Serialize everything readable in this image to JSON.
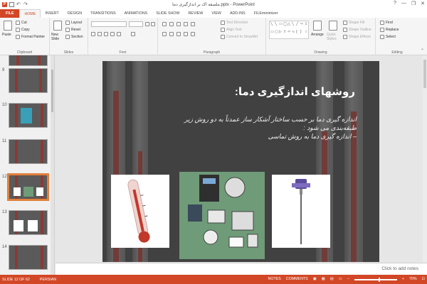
{
  "window": {
    "title": "ملصفه اک بر اندازگیری دما.pptx - PowerPoint",
    "controls": [
      "?",
      "—",
      "❐",
      "✕"
    ]
  },
  "tabs": [
    "FILE",
    "HOME",
    "INSERT",
    "DESIGN",
    "TRANSITIONS",
    "ANIMATIONS",
    "SLIDE SHOW",
    "REVIEW",
    "VIEW",
    "ADD-INS",
    "FILEminimizer"
  ],
  "active_tab": "HOME",
  "ribbon": {
    "clipboard": {
      "label": "Clipboard",
      "paste": "Paste",
      "cut": "Cut",
      "copy": "Copy",
      "format_painter": "Format Painter"
    },
    "slides": {
      "label": "Slides",
      "new_slide": "New Slide",
      "layout": "Layout",
      "reset": "Reset",
      "section": "Section"
    },
    "font": {
      "label": "Font"
    },
    "paragraph": {
      "label": "Paragraph",
      "text_direction": "Text Direction",
      "align_text": "Align Text",
      "convert_smartart": "Convert to SmartArt"
    },
    "drawing": {
      "label": "Drawing",
      "arrange": "Arrange",
      "quick_styles": "Quick Styles",
      "shape_fill": "Shape Fill",
      "shape_outline": "Shape Outline",
      "shape_effects": "Shape Effects"
    },
    "editing": {
      "label": "Editing",
      "find": "Find",
      "replace": "Replace",
      "select": "Select"
    }
  },
  "slide_panel": {
    "thumbnails": [
      {
        "num": "9"
      },
      {
        "num": "10"
      },
      {
        "num": "11"
      },
      {
        "num": "12"
      },
      {
        "num": "13"
      },
      {
        "num": "14"
      }
    ],
    "selected": "12"
  },
  "slide": {
    "title": "روشهای اندازگیری دما:",
    "body_lines": [
      "اندازه گیری دما بر حسب ساختار آشکار ساز عمدتاً به دو روش زیر",
      "طبقه‌بندی می شود :",
      "– اندازه گیری دما به روش تماسی"
    ]
  },
  "notes_placeholder": "Click to add notes",
  "status": {
    "slide_info": "SLIDE 12 OF 62",
    "language": "PERSIAN",
    "notes": "NOTES",
    "comments": "COMMENTS",
    "zoom": "70%"
  },
  "colors": {
    "accent": "#d24726",
    "slide_bg": "#474747",
    "selected_thumb": "#e0803d"
  }
}
